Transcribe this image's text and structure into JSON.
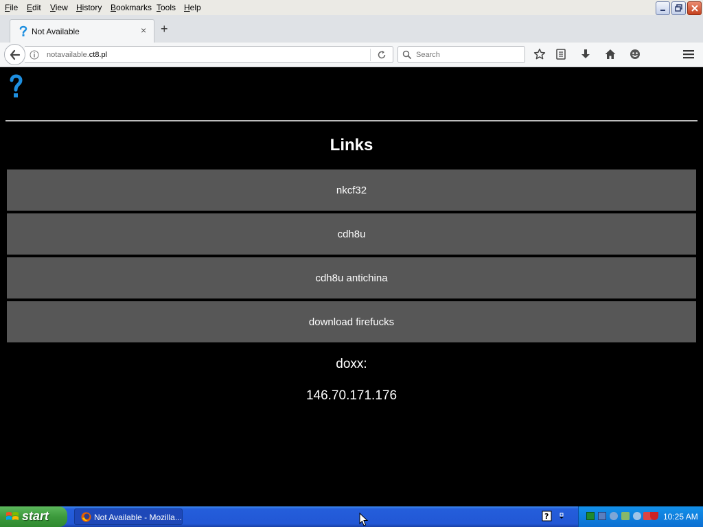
{
  "window": {
    "menu": [
      "File",
      "Edit",
      "View",
      "History",
      "Bookmarks",
      "Tools",
      "Help"
    ]
  },
  "tab": {
    "title": "Not Available",
    "close_glyph": "×",
    "new_tab_glyph": "+"
  },
  "navbar": {
    "url_prefix": "notavailable.",
    "url_domain": "ct8.pl",
    "search_placeholder": "Search"
  },
  "page": {
    "heading": "Links",
    "links": [
      "nkcf32",
      "cdh8u",
      "cdh8u antichina",
      "download firefucks"
    ],
    "doxx_label": "doxx:",
    "doxx_value": "146.70.171.176"
  },
  "taskbar": {
    "start_label": "start",
    "task_label": "Not Available - Mozilla...",
    "clock": "10:25 AM"
  },
  "colors": {
    "page_background": "#000000",
    "link_button": "#575757",
    "taskbar_blue": "#245edb",
    "start_green": "#3c9a3c"
  },
  "icons": [
    "back-arrow-icon",
    "info-icon",
    "reload-icon",
    "search-icon",
    "bookmark-star-icon",
    "reading-list-icon",
    "download-icon",
    "home-icon",
    "smiley-icon",
    "hamburger-menu-icon",
    "question-mark-logo-icon",
    "firefox-icon",
    "windows-logo-icon"
  ]
}
